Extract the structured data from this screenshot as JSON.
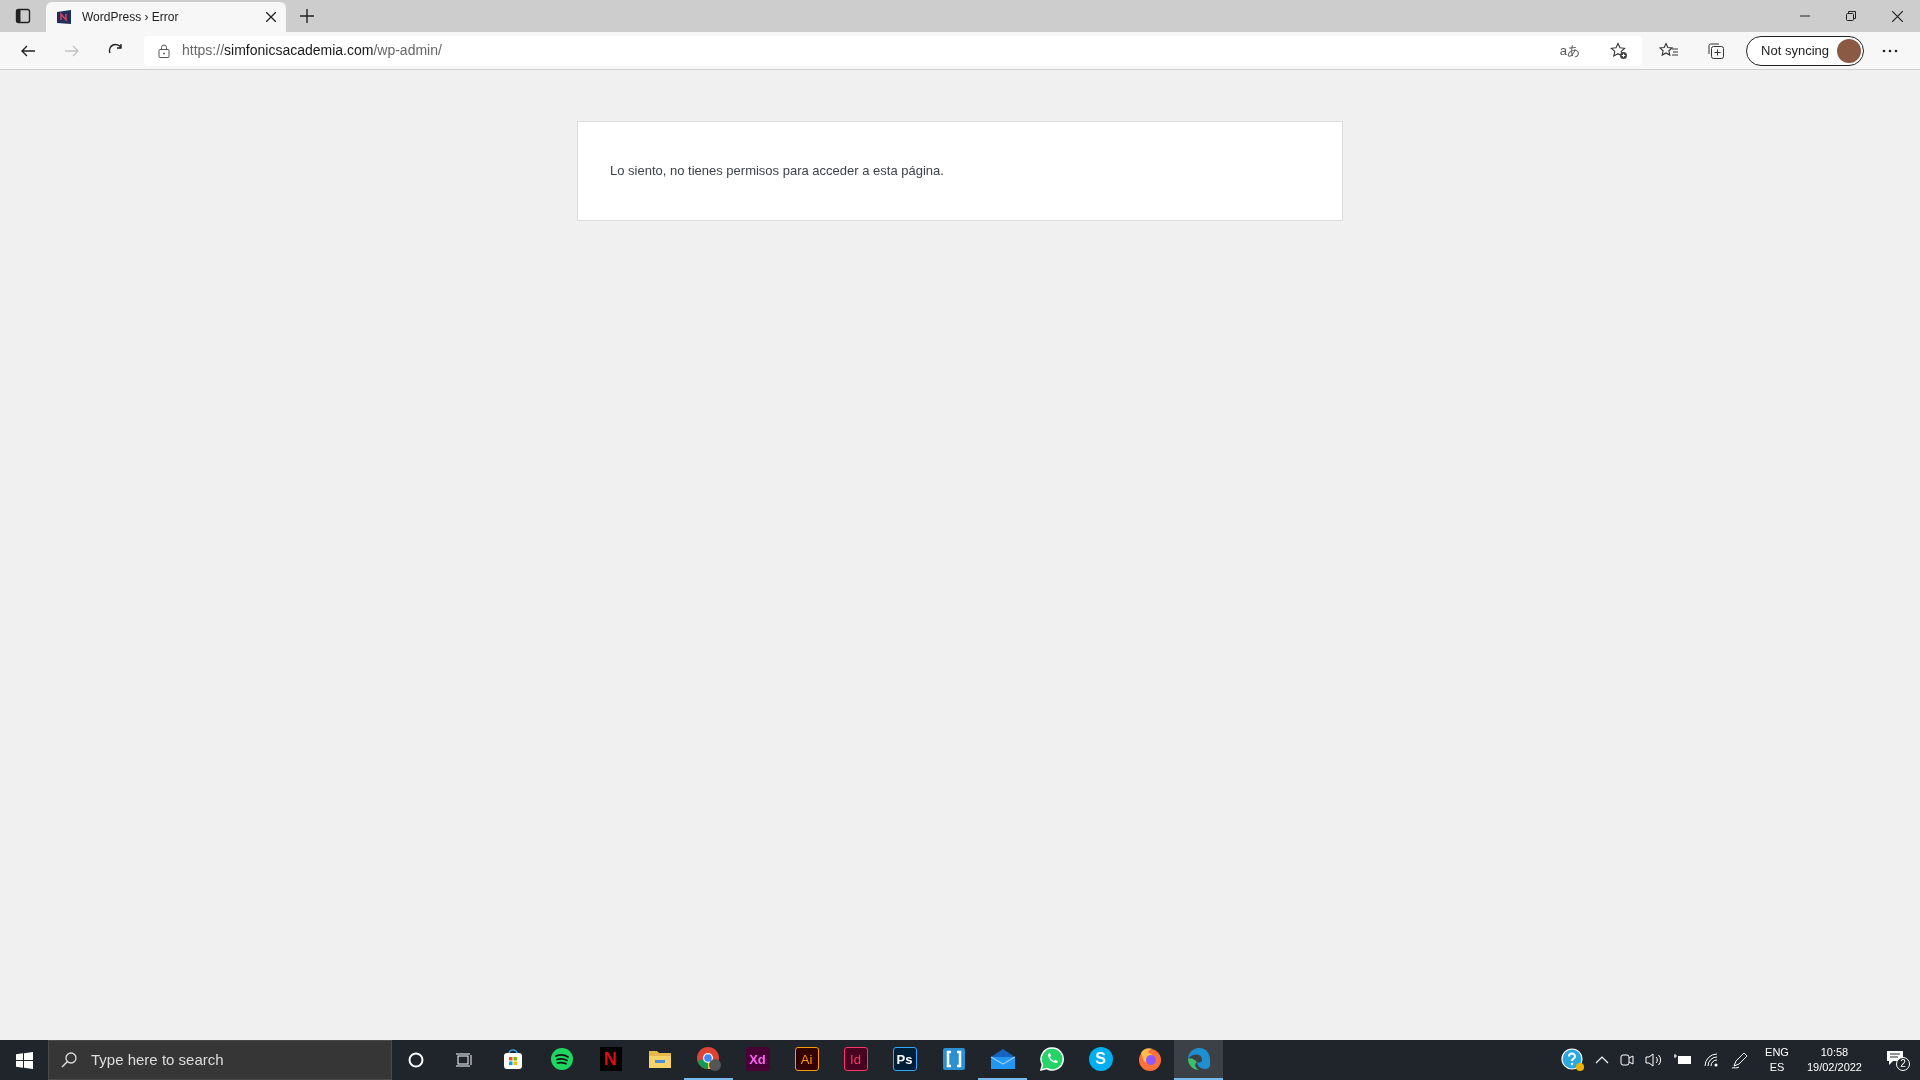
{
  "tabs": [
    {
      "title": "WordPress › Error",
      "selected": true
    }
  ],
  "nav": [
    {
      "kind": "back",
      "disabled": false
    },
    {
      "kind": "forward",
      "disabled": true
    },
    {
      "kind": "reload",
      "disabled": false
    }
  ],
  "address": {
    "scheme": "https://",
    "host": "simfonicsacademia.com",
    "path": "/wp-admin/"
  },
  "read_aloud": "aあ",
  "profile": {
    "label": "Not syncing"
  },
  "message": "Lo siento, no tienes permisos para acceder a esta página.",
  "taskbar": {
    "search_placeholder": "Type here to search",
    "apps": [
      {
        "kind": "store",
        "running": false,
        "selected": false
      },
      {
        "kind": "spotify",
        "running": false,
        "selected": false
      },
      {
        "kind": "netflix",
        "label": "N",
        "running": false,
        "selected": false
      },
      {
        "kind": "folder",
        "running": false,
        "selected": false
      },
      {
        "kind": "chrome",
        "running": true,
        "selected": false
      },
      {
        "kind": "xd",
        "label": "Xd",
        "running": false,
        "selected": false
      },
      {
        "kind": "ai",
        "label": "Ai",
        "running": false,
        "selected": false
      },
      {
        "kind": "id",
        "label": "Id",
        "running": false,
        "selected": false
      },
      {
        "kind": "ps",
        "label": "Ps",
        "running": false,
        "selected": false
      },
      {
        "kind": "bracket",
        "running": false,
        "selected": false
      },
      {
        "kind": "mail",
        "running": true,
        "selected": false
      },
      {
        "kind": "whatsapp",
        "running": false,
        "selected": false
      },
      {
        "kind": "skype",
        "label": "S",
        "running": false,
        "selected": false
      },
      {
        "kind": "firefox",
        "running": false,
        "selected": false
      },
      {
        "kind": "edge",
        "running": true,
        "selected": true
      }
    ],
    "language": {
      "primary": "ENG",
      "secondary": "ES"
    },
    "time": "10:58",
    "date": "19/02/2022",
    "notifications": "2"
  }
}
